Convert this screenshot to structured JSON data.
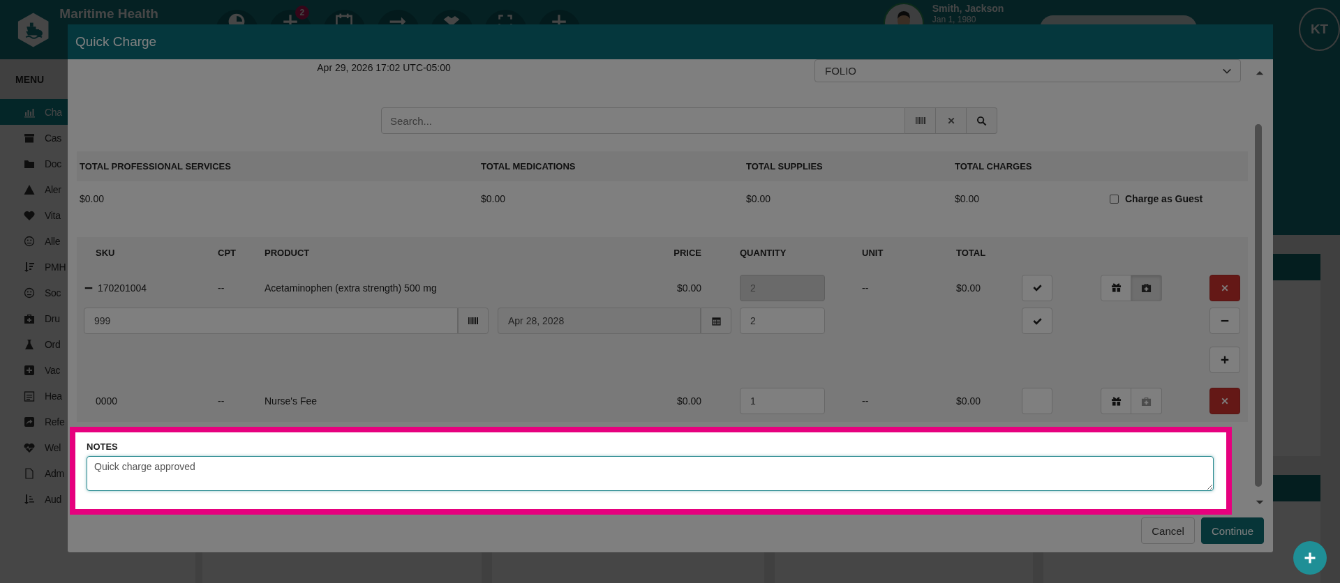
{
  "app_header": {
    "brand": "Maritime Health",
    "notification_badge": "2",
    "patient": {
      "name": "Smith, Jackson",
      "dob": "Jan 1, 1980"
    },
    "user_initials": "KT"
  },
  "sidebar": {
    "title": "MENU",
    "items": [
      {
        "label": "Cha",
        "selected": true
      },
      {
        "label": "Cas",
        "selected": false
      },
      {
        "label": "Doc",
        "selected": false
      },
      {
        "label": "Aler",
        "selected": false
      },
      {
        "label": "Vita",
        "selected": false
      },
      {
        "label": "Alle",
        "selected": false
      },
      {
        "label": "PMH",
        "selected": false
      },
      {
        "label": "Soc",
        "selected": false
      },
      {
        "label": "Dru",
        "selected": false
      },
      {
        "label": "Ord",
        "selected": false
      },
      {
        "label": "Vac",
        "selected": false
      },
      {
        "label": "Hea",
        "selected": false
      },
      {
        "label": "Refe",
        "selected": false
      },
      {
        "label": "Wel",
        "selected": false
      },
      {
        "label": "Adm",
        "selected": false
      },
      {
        "label": "Aud",
        "selected": false
      }
    ]
  },
  "dialog": {
    "title": "Quick Charge",
    "timestamp": "Apr 29, 2026 17:02 UTC-05:00",
    "folio": "FOLIO",
    "search": {
      "placeholder": "Search..."
    },
    "totals": [
      {
        "label": "TOTAL PROFESSIONAL SERVICES",
        "value": "$0.00"
      },
      {
        "label": "TOTAL MEDICATIONS",
        "value": "$0.00"
      },
      {
        "label": "TOTAL SUPPLIES",
        "value": "$0.00"
      },
      {
        "label": "TOTAL CHARGES",
        "value": "$0.00"
      }
    ],
    "charge_as_guest": {
      "label": "Charge as Guest",
      "checked": false
    },
    "columns": [
      "SKU",
      "CPT",
      "PRODUCT",
      "PRICE",
      "QUANTITY",
      "UNIT",
      "TOTAL"
    ],
    "items": [
      {
        "sku": "170201004",
        "expanded": true,
        "cpt": "--",
        "product": "Acetaminophen (extra strength) 500 mg",
        "price": "$0.00",
        "quantity": "2",
        "quantity_disabled": true,
        "unit": "--",
        "total": "$0.00",
        "confirmed": true,
        "gift_selected": false,
        "kit_selected": true,
        "lot": {
          "number": "999",
          "expiry": "Apr 28, 2028",
          "quantity": "2",
          "confirmed": true
        }
      },
      {
        "sku": "0000",
        "cpt": "--",
        "product": "Nurse's Fee",
        "price": "$0.00",
        "quantity": "1",
        "quantity_disabled": false,
        "unit": "--",
        "total": "$0.00",
        "confirmed": false,
        "gift_selected": false,
        "kit_selected": false
      }
    ],
    "notes": {
      "label": "NOTES",
      "value": "Quick charge approved"
    },
    "buttons": [
      {
        "label": "Cancel",
        "kind": "secondary"
      },
      {
        "label": "Continue",
        "kind": "primary"
      }
    ]
  }
}
